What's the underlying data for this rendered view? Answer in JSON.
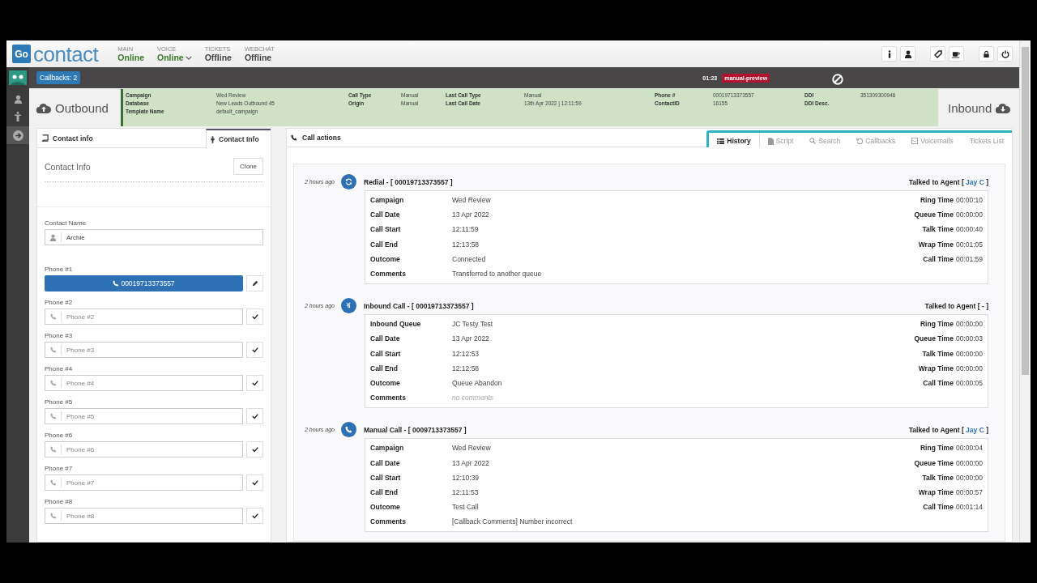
{
  "header": {
    "logo_badge": "Go",
    "logo_text": "contact",
    "statuses": [
      {
        "label": "MAIN",
        "value": "Online",
        "online": true,
        "dropdown": false
      },
      {
        "label": "VOICE",
        "value": "Online",
        "online": true,
        "dropdown": true
      },
      {
        "label": "TICKETS",
        "value": "Offline",
        "online": false,
        "dropdown": false
      },
      {
        "label": "WEBCHAT",
        "value": "Offline",
        "online": false,
        "dropdown": false
      }
    ]
  },
  "toolbar": {
    "callbacks": "Callbacks: 2",
    "timer": "01:23",
    "mode": "manual-preview"
  },
  "info": {
    "outbound": "Outbound",
    "inbound": "Inbound",
    "groups": [
      [
        {
          "label": "Campaign",
          "value": "Wed Review"
        },
        {
          "label": "Database",
          "value": "New Leads Outbound 45"
        },
        {
          "label": "Template Name",
          "value": "default_campaign"
        }
      ],
      [
        {
          "label": "Call Type",
          "value": "Manual"
        },
        {
          "label": "Origin",
          "value": "Manual"
        }
      ],
      [
        {
          "label": "Last Call Type",
          "value": "Manual"
        },
        {
          "label": "Last Call Date",
          "value": "13th Apr 2022 | 12:11:59"
        }
      ],
      [
        {
          "label": "Phone #",
          "value": "00019713373557"
        },
        {
          "label": "ContactID",
          "value": "16155"
        }
      ],
      [
        {
          "label": "DDI",
          "value": "351309300946"
        },
        {
          "label": "DDI Desc."
        }
      ]
    ]
  },
  "contact": {
    "tabs": [
      {
        "label": "Contact info",
        "selected": false
      },
      {
        "label": "Contact Info",
        "selected": true
      }
    ],
    "title": "Contact Info",
    "clone": "Clone",
    "name_label": "Contact Name",
    "name_value": "Archie",
    "phones": [
      {
        "label": "Phone #1",
        "kind": "dial",
        "value": "00019713373557"
      },
      {
        "label": "Phone #2",
        "kind": "input",
        "placeholder": "Phone #2"
      },
      {
        "label": "Phone #3",
        "kind": "input",
        "placeholder": "Phone #3"
      },
      {
        "label": "Phone #4",
        "kind": "input",
        "placeholder": "Phone #4"
      },
      {
        "label": "Phone #5",
        "kind": "input",
        "placeholder": "Phone #5"
      },
      {
        "label": "Phone #6",
        "kind": "input",
        "placeholder": "Phone #6"
      },
      {
        "label": "Phone #7",
        "kind": "input",
        "placeholder": "Phone #7"
      },
      {
        "label": "Phone #8",
        "kind": "input",
        "placeholder": "Phone #8"
      }
    ]
  },
  "actions": {
    "title": "Call actions",
    "tabs": [
      {
        "label": "History",
        "selected": true
      },
      {
        "label": "Script",
        "selected": false
      },
      {
        "label": "Search",
        "selected": false
      },
      {
        "label": "Callbacks",
        "selected": false
      },
      {
        "label": "Voicemails",
        "selected": false
      },
      {
        "label": "Tickets List",
        "selected": false
      }
    ],
    "history": [
      {
        "time": "2 hours ago",
        "kind": "redial",
        "title": "Redial - [ 00019713373557 ]",
        "agent_prefix": "Talked to Agent [",
        "agent": "Jay C",
        "agent_linked": true,
        "agent_suffix": "]",
        "details": [
          {
            "label": "Campaign",
            "value": "Wed Review",
            "empty": false
          },
          {
            "label": "Call Date",
            "value": "13 Apr 2022",
            "empty": false
          },
          {
            "label": "Call Start",
            "value": "12:11:59",
            "empty": false
          },
          {
            "label": "Call End",
            "value": "12:13:58",
            "empty": false
          },
          {
            "label": "Outcome",
            "value": "Connected",
            "empty": false
          },
          {
            "label": "Comments",
            "value": "Transferred to another queue",
            "empty": false
          }
        ],
        "times": [
          {
            "label": "Ring Time",
            "value": "00:00:10"
          },
          {
            "label": "Queue Time",
            "value": "00:00:00"
          },
          {
            "label": "Talk Time",
            "value": "00:00:40"
          },
          {
            "label": "Wrap Time",
            "value": "00:01:05"
          },
          {
            "label": "Call Time",
            "value": "00:01:59"
          }
        ]
      },
      {
        "time": "2 hours ago",
        "kind": "inbound",
        "title": "Inbound Call - [ 00019713373557 ]",
        "agent_prefix": "Talked to Agent [",
        "agent": "-",
        "agent_linked": false,
        "agent_suffix": "]",
        "details": [
          {
            "label": "Inbound Queue",
            "value": "JC Testy Test",
            "empty": false
          },
          {
            "label": "Call Date",
            "value": "13 Apr 2022",
            "empty": false
          },
          {
            "label": "Call Start",
            "value": "12:12:53",
            "empty": false
          },
          {
            "label": "Call End",
            "value": "12:12:58",
            "empty": false
          },
          {
            "label": "Outcome",
            "value": "Queue Abandon",
            "empty": false
          },
          {
            "label": "Comments",
            "value": "no comments",
            "empty": true
          }
        ],
        "times": [
          {
            "label": "Ring Time",
            "value": "00:00:00"
          },
          {
            "label": "Queue Time",
            "value": "00:00:03"
          },
          {
            "label": "Talk Time",
            "value": "00:00:00"
          },
          {
            "label": "Wrap Time",
            "value": "00:00:00"
          },
          {
            "label": "Call Time",
            "value": "00:00:05"
          }
        ]
      },
      {
        "time": "2 hours ago",
        "kind": "manual",
        "title": "Manual Call - [ 0009713373557 ]",
        "agent_prefix": "Talked to Agent [",
        "agent": "Jay C",
        "agent_linked": true,
        "agent_suffix": "]",
        "details": [
          {
            "label": "Campaign",
            "value": "Wed Review",
            "empty": false
          },
          {
            "label": "Call Date",
            "value": "13 Apr 2022",
            "empty": false
          },
          {
            "label": "Call Start",
            "value": "12:10:39",
            "empty": false
          },
          {
            "label": "Call End",
            "value": "12:11:53",
            "empty": false
          },
          {
            "label": "Outcome",
            "value": "Test Call",
            "empty": false
          },
          {
            "label": "Comments",
            "value": "[Callback Comments] Number incorrect",
            "empty": false
          }
        ],
        "times": [
          {
            "label": "Ring Time",
            "value": "00:00:04"
          },
          {
            "label": "Queue Time",
            "value": "00:00:00"
          },
          {
            "label": "Talk Time",
            "value": "00:00:00"
          },
          {
            "label": "Wrap Time",
            "value": "00:00:57"
          },
          {
            "label": "Call Time",
            "value": "00:01:14"
          }
        ]
      }
    ]
  }
}
